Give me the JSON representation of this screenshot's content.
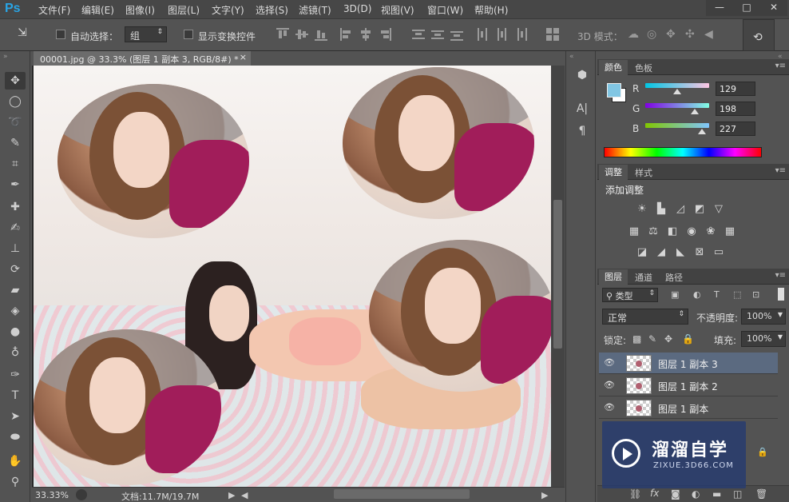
{
  "app": {
    "logo": "Ps"
  },
  "menu": [
    "文件(F)",
    "编辑(E)",
    "图像(I)",
    "图层(L)",
    "文字(Y)",
    "选择(S)",
    "滤镜(T)",
    "3D(D)",
    "视图(V)",
    "窗口(W)",
    "帮助(H)"
  ],
  "window_controls": {
    "minimize": "—",
    "maximize": "□",
    "close": "✕"
  },
  "options": {
    "auto_select_label": "自动选择：",
    "auto_select_value": "组",
    "show_transform_label": "显示变换控件",
    "mode_3d_label": "3D 模式："
  },
  "document": {
    "tab_title": "00001.jpg @ 33.3% (图层 1 副本 3, RGB/8#) *",
    "tab_close": "×",
    "zoom": "33.33%",
    "doc_info": "文档:11.7M/19.7M"
  },
  "color_panel": {
    "tabs": [
      "颜色",
      "色板"
    ],
    "channels": [
      {
        "label": "R",
        "value": "129",
        "fraction": 0.506
      },
      {
        "label": "G",
        "value": "198",
        "fraction": 0.776
      },
      {
        "label": "B",
        "value": "227",
        "fraction": 0.89
      }
    ],
    "foreground": "#81c6e3",
    "background": "#ffffff"
  },
  "adjust_panel": {
    "tabs": [
      "调整",
      "样式"
    ],
    "title": "添加调整"
  },
  "layers_panel": {
    "tabs": [
      "图层",
      "通道",
      "路径"
    ],
    "filter_kind": "类型",
    "blend_mode": "正常",
    "opacity_label": "不透明度:",
    "opacity_value": "100%",
    "lock_label": "锁定:",
    "fill_label": "填充:",
    "fill_value": "100%",
    "layers": [
      {
        "name": "图层 1 副本 3",
        "selected": true
      },
      {
        "name": "图层 1 副本 2",
        "selected": false
      },
      {
        "name": "图层 1 副本",
        "selected": false
      }
    ]
  },
  "watermark": {
    "brand": "溜溜自学",
    "url": "ZIXUE.3D66.COM"
  }
}
